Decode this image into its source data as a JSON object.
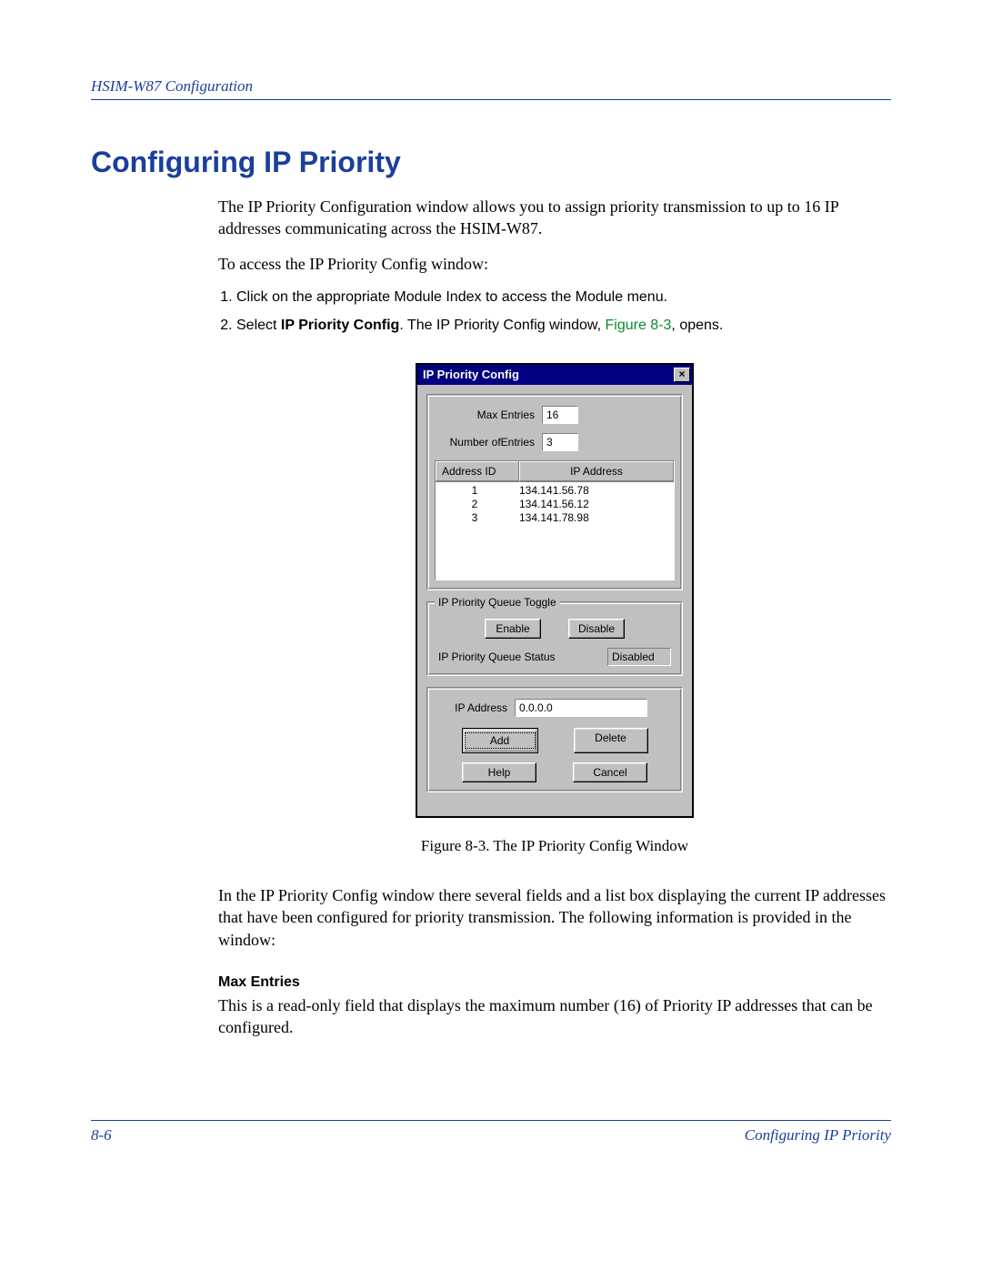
{
  "header": {
    "running": "HSIM-W87 Configuration"
  },
  "title": "Configuring IP Priority",
  "intro1": "The IP Priority Configuration window allows you to assign priority transmission to up to 16 IP addresses communicating across the HSIM-W87.",
  "intro2": "To access the IP Priority Config window:",
  "steps": {
    "s1": "Click on the appropriate Module Index to access the Module menu.",
    "s2_a": "Select ",
    "s2_b": "IP Priority Config",
    "s2_c": ". The IP Priority Config window, ",
    "s2_ref": "Figure 8-3",
    "s2_d": ", opens."
  },
  "dialog": {
    "title": "IP Priority Config",
    "close": "×",
    "maxEntriesLabel": "Max Entries",
    "maxEntriesValue": "16",
    "numEntriesLabel": "Number ofEntries",
    "numEntriesValue": "3",
    "colAddressId": "Address ID",
    "colIpAddress": "IP Address",
    "rows": [
      {
        "id": "1",
        "ip": "134.141.56.78"
      },
      {
        "id": "2",
        "ip": "134.141.56.12"
      },
      {
        "id": "3",
        "ip": "134.141.78.98"
      }
    ],
    "toggleGroup": "IP Priority Queue Toggle",
    "enable": "Enable",
    "disable": "Disable",
    "statusLabel": "IP Priority Queue Status",
    "statusValue": "Disabled",
    "ipAddressLabel": "IP Address",
    "ipAddressValue": "0.0.0.0",
    "add": "Add",
    "delete": "Delete",
    "help": "Help",
    "cancel": "Cancel"
  },
  "caption": "Figure 8-3.  The IP Priority Config Window",
  "para2": "In the IP Priority Config window there several fields and a list box displaying the current IP addresses that have been configured for priority transmission. The following information is provided in the window:",
  "maxEntriesHead": "Max Entries",
  "maxEntriesBody": "This is a read-only field that displays the maximum number (16) of Priority IP addresses that can be configured.",
  "footer": {
    "page": "8-6",
    "section": "Configuring IP Priority"
  }
}
